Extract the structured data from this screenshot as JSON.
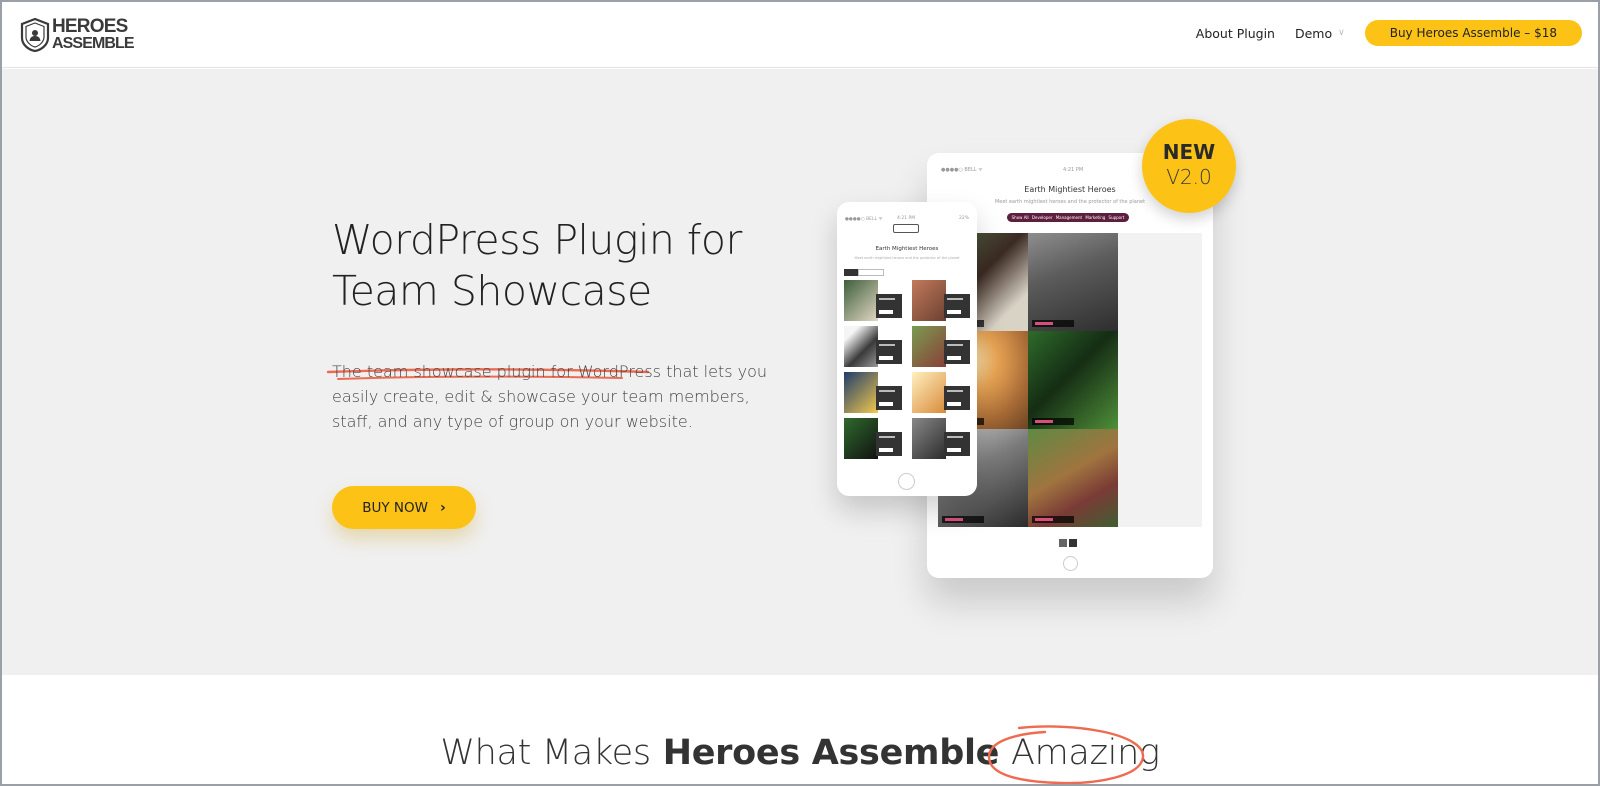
{
  "colors": {
    "accent": "#fcc316",
    "hero_bg": "#f0f0f0",
    "underline": "#ee6a50",
    "filter_bar": "#5d1f3d"
  },
  "header": {
    "logo": {
      "line1": "HEROES",
      "line2": "ASSEMBLE"
    },
    "nav": {
      "about": "About Plugin",
      "demo": "Demo",
      "buy": "Buy Heroes Assemble – $18"
    }
  },
  "hero": {
    "title_line1": "WordPress Plugin for",
    "title_line2": "Team Showcase",
    "description": "The team showcase plugin for WordPress that lets you easily create, edit & showcase your team members, staff, and any type of group on your website.",
    "buy_now": "BUY NOW"
  },
  "badge": {
    "new": "NEW",
    "version": "V2.0"
  },
  "mockup": {
    "tablet": {
      "carrier": "●●●●○ BELL ᯤ",
      "time": "4:21 PM",
      "title": "Earth Mightiest Heroes",
      "subtitle": "Meet earth mightiest heroes and the protector of the planet",
      "filters": [
        "Show All",
        "Developer",
        "Management",
        "Marketing",
        "Support"
      ]
    },
    "phone": {
      "carrier": "●●●●○ BELL ᯤ",
      "time": "4:21 PM",
      "battery": "22%",
      "title": "Earth Mightiest Heroes",
      "subtitle": "Meet earth mightiest heroes and the protector of the planet"
    }
  },
  "section": {
    "title_part1": "What Makes",
    "title_part2": "Heroes Assemble",
    "title_part3": "Amazing"
  }
}
